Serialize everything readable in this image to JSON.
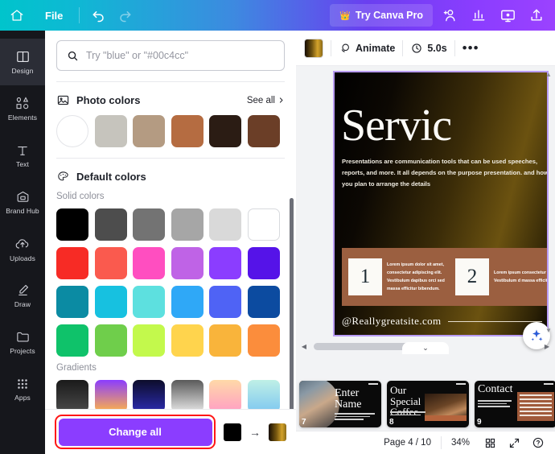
{
  "topbar": {
    "home_icon": "home-icon",
    "file_label": "File",
    "undo_icon": "undo-icon",
    "redo_icon": "redo-icon",
    "pro_label": "Try Canva Pro",
    "crown_icon": "crown-icon",
    "right_icons": [
      {
        "name": "add-collaborator-icon"
      },
      {
        "name": "insights-chart-icon"
      },
      {
        "name": "present-icon"
      },
      {
        "name": "share-upload-icon"
      }
    ]
  },
  "sidebar": {
    "items": [
      {
        "label": "Design",
        "icon": "design-icon",
        "active": true
      },
      {
        "label": "Elements",
        "icon": "elements-icon",
        "active": false
      },
      {
        "label": "Text",
        "icon": "text-icon",
        "active": false
      },
      {
        "label": "Brand Hub",
        "icon": "brand-hub-icon",
        "active": false
      },
      {
        "label": "Uploads",
        "icon": "uploads-icon",
        "active": false
      },
      {
        "label": "Draw",
        "icon": "draw-icon",
        "active": false
      },
      {
        "label": "Projects",
        "icon": "projects-icon",
        "active": false
      },
      {
        "label": "Apps",
        "icon": "apps-icon",
        "active": false
      }
    ]
  },
  "panel": {
    "search": {
      "icon": "search-icon",
      "value": "",
      "placeholder": "Try \"blue\" or \"#00c4cc\""
    },
    "photo_colors": {
      "icon": "image-icon",
      "title": "Photo colors",
      "see_all_label": "See all",
      "chevron_icon": "chevron-right-icon",
      "swatches": [
        {
          "name": "photo-thumbnail",
          "hex": "#d8b394"
        },
        {
          "name": "swatch-light-gray",
          "hex": "#c6c4bd"
        },
        {
          "name": "swatch-tan",
          "hex": "#b49b82"
        },
        {
          "name": "swatch-terracotta",
          "hex": "#b56c41"
        },
        {
          "name": "swatch-dark-brown",
          "hex": "#2b1c14"
        },
        {
          "name": "swatch-brown",
          "hex": "#6b3e27"
        }
      ]
    },
    "default_colors": {
      "icon": "palette-icon",
      "title": "Default colors",
      "solid_label": "Solid colors",
      "solid_rows": [
        [
          "#000000",
          "#4d4d4d",
          "#737373",
          "#a6a6a6",
          "#d9d9d9",
          "#ffffff"
        ],
        [
          "#f72b25",
          "#fa5a4e",
          "#ff4ec0",
          "#bf63e6",
          "#8b3dff",
          "#5513e8"
        ],
        [
          "#0b8ba3",
          "#17c1e0",
          "#5de0df",
          "#2fa8f7",
          "#4f63f5",
          "#0c4ba0"
        ],
        [
          "#0fc26a",
          "#6fce4b",
          "#c3f94c",
          "#ffd44d",
          "#f9b43b",
          "#fb8d3c"
        ]
      ],
      "gradients_label": "Gradients",
      "gradient_row": [
        {
          "name": "gradient-black",
          "css": "linear-gradient(180deg,#1a1a1a,#4a4a4a)"
        },
        {
          "name": "gradient-purple-gold",
          "css": "linear-gradient(180deg,#8b3dff,#ffb347)"
        },
        {
          "name": "gradient-navy",
          "css": "linear-gradient(180deg,#0d0d2b,#2b2bb0)"
        },
        {
          "name": "gradient-silver",
          "css": "linear-gradient(180deg,#5a5a5a,#e6e6e6)"
        },
        {
          "name": "gradient-peach-pink",
          "css": "linear-gradient(180deg,#ffd9a8,#ff9ec4)"
        },
        {
          "name": "gradient-mint-blue",
          "css": "linear-gradient(180deg,#bff0e6,#7fc8f0)"
        }
      ]
    },
    "bottom": {
      "change_all_label": "Change all",
      "from_color": "#000000",
      "arrow_icon": "arrow-right-icon",
      "to_color": "#8a6a18",
      "highlight_color": "#ff1616"
    }
  },
  "editor": {
    "toolbar": {
      "color_swatch_name": "page-color-swatch",
      "animate_label": "Animate",
      "animate_icon": "animate-icon",
      "duration_label": "5.0s",
      "clock_icon": "clock-icon",
      "more_label": "•••"
    },
    "slide": {
      "title": "Servic",
      "body": "Presentations are communication tools that can be used speeches, reports, and more. It all depends on the purpose presentation. and how you plan to arrange the details",
      "cards": [
        {
          "number": "1",
          "text": "Lorem ipsum dolor sit amet, consectetur adipiscing elit. Vestibulum dapibus orci sed massa efficitur bibendum."
        },
        {
          "number": "2",
          "text": "Lorem ipsum consectetur a Vestibulum d massa efficitur"
        }
      ],
      "footer_site": "@Reallygreatsite.com",
      "magic_icon": "magic-sparkle-icon"
    },
    "thumbnails": [
      {
        "number": "7",
        "title": "Enter Name",
        "kind": "photo-name"
      },
      {
        "number": "8",
        "title": "Our Special Coffee",
        "kind": "coffee"
      },
      {
        "number": "9",
        "title": "Contact",
        "kind": "contact"
      }
    ],
    "scrollbars": {
      "left_arrow_icon": "caret-left-icon",
      "right_arrow_icon": "caret-right-icon",
      "up_arrow_icon": "caret-up-icon",
      "down_arrow_icon": "caret-down-icon",
      "collapse_icon": "chevron-down-icon"
    },
    "statusbar": {
      "page_label": "Page 4 / 10",
      "zoom_label": "34%",
      "grid_icon": "grid-view-icon",
      "expand_icon": "fullscreen-icon",
      "help_icon": "help-icon"
    }
  }
}
